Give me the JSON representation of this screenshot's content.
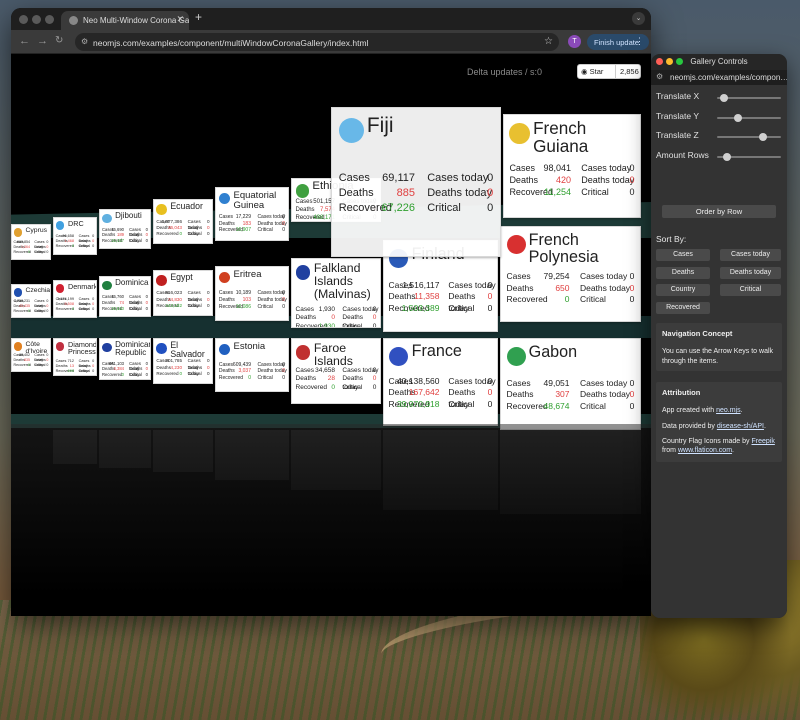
{
  "browser": {
    "tab_title": "Neo Multi-Window Corona Ga…",
    "url": "neomjs.com/examples/component/multiWindowCoronaGallery/index.html",
    "avatar_letter": "T",
    "finish_update": "Finish update"
  },
  "app": {
    "delta_updates": "Delta updates / s:0",
    "github_star": "Star",
    "github_count": "2,856",
    "labels": {
      "cases": "Cases",
      "deaths": "Deaths",
      "recovered": "Recovered",
      "cases_today": "Cases today",
      "deaths_today": "Deaths today",
      "critical": "Critical"
    }
  },
  "cards": [
    {
      "name": "Fiji",
      "cases": "69,117",
      "deaths": "885",
      "recovered": "67,226",
      "cases_today": "0",
      "deaths_today": "0",
      "critical": "0",
      "flag": "fiji-flag-icon",
      "color": "#68b8e8"
    },
    {
      "name": "French\nGuiana",
      "cases": "98,041",
      "deaths": "420",
      "recovered": "11,254",
      "cases_today": "0",
      "deaths_today": "0",
      "critical": "0",
      "flag": "french-guiana-flag-icon",
      "color": "#e8c030"
    },
    {
      "name": "Finland",
      "cases": "1,516,117",
      "deaths": "11,358",
      "recovered": "1,503,389",
      "cases_today": "0",
      "deaths_today": "0",
      "critical": "0",
      "flag": "finland-flag-icon",
      "color": "#2a5ab8"
    },
    {
      "name": "French\nPolynesia",
      "cases": "79,254",
      "deaths": "650",
      "recovered": "0",
      "cases_today": "0",
      "deaths_today": "0",
      "critical": "0",
      "flag": "french-polynesia-flag-icon",
      "color": "#d83030"
    },
    {
      "name": "France",
      "cases": "40,138,560",
      "deaths": "167,642",
      "recovered": "39,970,918",
      "cases_today": "0",
      "deaths_today": "0",
      "critical": "0",
      "flag": "france-flag-icon",
      "color": "#3050c0"
    },
    {
      "name": "Gabon",
      "cases": "49,051",
      "deaths": "307",
      "recovered": "48,674",
      "cases_today": "0",
      "deaths_today": "0",
      "critical": "0",
      "flag": "gabon-flag-icon",
      "color": "#30a050"
    },
    {
      "name": "Ethiopia",
      "cases": "501,157",
      "deaths": "7,574",
      "recovered": "488,171",
      "cases_today": "0",
      "deaths_today": "0",
      "critical": "0",
      "flag": "ethiopia-flag-icon",
      "color": "#40a040"
    },
    {
      "name": "Falkland\nIslands\n(Malvinas)",
      "cases": "1,930",
      "deaths": "0",
      "recovered": "1,930",
      "cases_today": "0",
      "deaths_today": "0",
      "critical": "0",
      "flag": "falkland-flag-icon",
      "color": "#2040a0"
    },
    {
      "name": "Faroe Islands",
      "cases": "34,658",
      "deaths": "28",
      "recovered": "0",
      "cases_today": "0",
      "deaths_today": "0",
      "critical": "0",
      "flag": "faroe-flag-icon",
      "color": "#c03030"
    },
    {
      "name": "Equatorial\nGuinea",
      "cases": "17,229",
      "deaths": "183",
      "recovered": "16,907",
      "cases_today": "0",
      "deaths_today": "0",
      "critical": "0",
      "flag": "equatorial-guinea-flag-icon",
      "color": "#3080d0"
    },
    {
      "name": "Eritrea",
      "cases": "10,189",
      "deaths": "103",
      "recovered": "10,086",
      "cases_today": "0",
      "deaths_today": "0",
      "critical": "0",
      "flag": "eritrea-flag-icon",
      "color": "#d04020"
    },
    {
      "name": "Estonia",
      "cases": "609,439",
      "deaths": "3,037",
      "recovered": "0",
      "cases_today": "0",
      "deaths_today": "0",
      "critical": "0",
      "flag": "estonia-flag-icon",
      "color": "#2060c0"
    },
    {
      "name": "Ecuador",
      "cases": "1,077,386",
      "deaths": "36,043",
      "recovered": "0",
      "cases_today": "0",
      "deaths_today": "0",
      "critical": "0",
      "flag": "ecuador-flag-icon",
      "color": "#e8c020"
    },
    {
      "name": "Egypt",
      "cases": "516,023",
      "deaths": "24,830",
      "recovered": "442,182",
      "cases_today": "0",
      "deaths_today": "0",
      "critical": "0",
      "flag": "egypt-flag-icon",
      "color": "#c02020"
    },
    {
      "name": "El Salvador",
      "cases": "201,785",
      "deaths": "4,230",
      "recovered": "0",
      "cases_today": "0",
      "deaths_today": "0",
      "critical": "0",
      "flag": "el-salvador-flag-icon",
      "color": "#2050c0"
    },
    {
      "name": "Djibouti",
      "cases": "15,690",
      "deaths": "189",
      "recovered": "15,427",
      "cases_today": "0",
      "deaths_today": "0",
      "critical": "0",
      "flag": "djibouti-flag-icon",
      "color": "#60b0e0"
    },
    {
      "name": "Dominica",
      "cases": "15,760",
      "deaths": "74",
      "recovered": "15,610",
      "cases_today": "0",
      "deaths_today": "0",
      "critical": "0",
      "flag": "dominica-flag-icon",
      "color": "#208040"
    },
    {
      "name": "Dominican\nRepublic",
      "cases": "661,103",
      "deaths": "4,384",
      "recovered": "0",
      "cases_today": "0",
      "deaths_today": "0",
      "critical": "0",
      "flag": "dominican-flag-icon",
      "color": "#2040a0"
    },
    {
      "name": "DRC",
      "cases": "96,658",
      "deaths": "1,468",
      "recovered": "0",
      "cases_today": "0",
      "deaths_today": "0",
      "critical": "0",
      "flag": "drc-flag-icon",
      "color": "#40a0e0"
    },
    {
      "name": "Denmark",
      "cases": "3,174,199",
      "deaths": "8,508",
      "recovered": "0",
      "cases_today": "0",
      "deaths_today": "0",
      "critical": "0",
      "flag": "denmark-flag-icon",
      "color": "#d02030"
    },
    {
      "name": "Diamond\nPrincess",
      "cases": "712",
      "deaths": "13",
      "recovered": "699",
      "cases_today": "0",
      "deaths_today": "0",
      "critical": "0",
      "flag": "diamond-princess-flag-icon",
      "color": "#c03040"
    },
    {
      "name": "Cyprus",
      "cases": "660,854",
      "deaths": "1,364",
      "recovered": "0",
      "cases_today": "0",
      "deaths_today": "0",
      "critical": "0",
      "flag": "cyprus-flag-icon",
      "color": "#e0a030"
    },
    {
      "name": "Czechia",
      "cases": "4,758,231",
      "deaths": "43,435",
      "recovered": "0",
      "cases_today": "0",
      "deaths_today": "0",
      "critical": "0",
      "flag": "czechia-flag-icon",
      "color": "#2050b0"
    },
    {
      "name": "Côte d'Ivoire",
      "cases": "88,402",
      "deaths": "835",
      "recovered": "0",
      "cases_today": "0",
      "deaths_today": "0",
      "critical": "0",
      "flag": "cote-divoire-flag-icon",
      "color": "#e08020"
    }
  ],
  "controls": {
    "title": "Gallery Controls",
    "url": "neomjs.com/examples/compon…",
    "sliders": [
      {
        "label": "Translate X",
        "value": 0.05
      },
      {
        "label": "Translate Y",
        "value": 0.3
      },
      {
        "label": "Translate Z",
        "value": 0.75
      },
      {
        "label": "Amount Rows",
        "value": 0.1
      }
    ],
    "order_button": "Order by Row",
    "sort_by": "Sort By:",
    "sort_buttons": [
      "Cases",
      "Cases today",
      "Deaths",
      "Deaths today",
      "Country",
      "Critical",
      "Recovered"
    ],
    "nav_title": "Navigation Concept",
    "nav_text": "You can use the Arrow Keys to walk through the items.",
    "attr_title": "Attribution",
    "attr_line1_a": "App created with ",
    "attr_line1_link": "neo.mjs",
    "attr_line2_a": "Data provided by ",
    "attr_line2_link": "disease-sh/API",
    "attr_line3_a": "Country Flag Icons made by ",
    "attr_line3_link": "Freepik",
    "attr_line3_b": "from ",
    "attr_line3_link2": "www.flaticon.com"
  }
}
